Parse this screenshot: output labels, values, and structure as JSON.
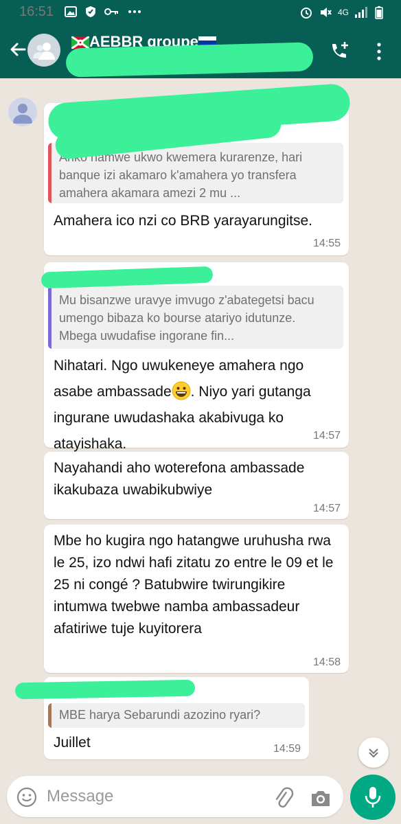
{
  "status_bar": {
    "time": "16:51",
    "network": "4G"
  },
  "header": {
    "title": "AEBBR groupe"
  },
  "messages": [
    {
      "quote": "Ariko namwe ukwo kwemera kurarenze, hari banque izi akamaro k'amahera yo transfera amahera akamara amezi 2 mu ...",
      "text": "Amahera ico nzi co BRB yarayarungitse.",
      "time": "14:55"
    },
    {
      "quote": "Mu bisanzwe uravye imvugo z'abategetsi bacu umengo bibaza ko bourse atariyo idutunze. Mbega uwudafise ingorane fin...",
      "text_before_emoji": "Nihatari. Ngo uwukeneye amahera ngo asabe ambassade",
      "text_after_emoji": ". Niyo yari gutanga ingurane uwudashaka akabivuga ko atayishaka.",
      "time": "14:57"
    },
    {
      "text": "Nayahandi aho woterefona ambassade ikakubaza uwabikubwiye",
      "time": "14:57"
    },
    {
      "text": "Mbe ho kugira ngo hatangwe uruhusha rwa le 25, izo ndwi hafi zitatu zo entre le 09 et le 25 ni congé ? Batubwire twirungikire intumwa twebwe namba ambassadeur afatiriwe tuje kuyitorera",
      "time": "14:58"
    },
    {
      "quote": "MBE harya Sebarundi azozino ryari?",
      "text": "Juillet",
      "time": "14:59"
    }
  ],
  "composer": {
    "placeholder": "Message"
  },
  "colors": {
    "header": "#075e54",
    "accent": "#00a884",
    "chat_bg": "#ece5dd",
    "quote_bar_1": "#e0555d",
    "quote_bar_2": "#7b6bd6",
    "quote_bar_3": "#a1785c"
  },
  "icons": [
    "back-arrow-icon",
    "group-avatar-icon",
    "add-call-icon",
    "more-vert-icon",
    "user-avatar-icon",
    "grinning-emoji-icon",
    "scroll-down-icon",
    "emoji-icon",
    "attach-icon",
    "camera-icon",
    "mic-icon"
  ]
}
